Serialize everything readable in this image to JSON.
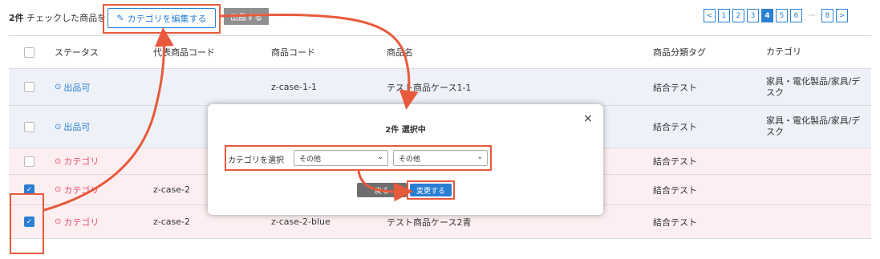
{
  "toolbar": {
    "selection_count": "2件",
    "selection_text": "チェックした商品を",
    "edit_category_label": "カテゴリを編集する",
    "list_button_label": "出品する"
  },
  "pagination": {
    "prev": "<",
    "pages": [
      "1",
      "2",
      "3",
      "4",
      "5",
      "6"
    ],
    "active": "4",
    "ellipsis": "···",
    "last": "8",
    "next": ">"
  },
  "table": {
    "headers": {
      "status": "ステータス",
      "rep_code": "代表商品コード",
      "code": "商品コード",
      "name": "商品名",
      "tag": "商品分類タグ",
      "category": "カテゴリ"
    },
    "rows": [
      {
        "checked": false,
        "status": "出品可",
        "status_kind": "ok",
        "rep_code": "",
        "code": "z-case-1-1",
        "name": "テスト商品ケース1-1",
        "tag": "結合テスト",
        "category": "家具・電化製品/家具/デスク"
      },
      {
        "checked": false,
        "status": "出品可",
        "status_kind": "ok",
        "rep_code": "",
        "code": "",
        "name": "",
        "tag": "結合テスト",
        "category": "家具・電化製品/家具/デスク"
      },
      {
        "checked": false,
        "status": "カテゴリ",
        "status_kind": "err",
        "rep_code": "",
        "code": "",
        "name": "",
        "tag": "結合テスト",
        "category": ""
      },
      {
        "checked": true,
        "status": "カテゴリ",
        "status_kind": "err",
        "rep_code": "z-case-2",
        "code": "",
        "name": "",
        "tag": "結合テスト",
        "category": ""
      },
      {
        "checked": true,
        "status": "カテゴリ",
        "status_kind": "err",
        "rep_code": "z-case-2",
        "code": "z-case-2-blue",
        "name": "テスト商品ケース2青",
        "tag": "結合テスト",
        "category": ""
      }
    ]
  },
  "modal": {
    "close": "×",
    "title": "2件 選択中",
    "select_label": "カテゴリを選択",
    "select1_value": "その他",
    "select2_value": "その他",
    "back_label": "戻る",
    "change_label": "変更する"
  },
  "colors": {
    "accent": "#2a7fd4",
    "highlight": "#e85a3c",
    "error": "#e0506a"
  }
}
